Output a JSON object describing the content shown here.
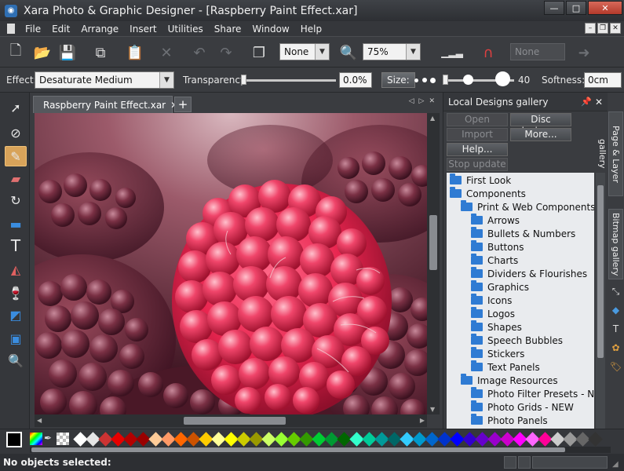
{
  "window": {
    "title": "Xara Photo & Graphic Designer - [Raspberry Paint Effect.xar]",
    "controls": [
      "—",
      "□",
      "✕"
    ]
  },
  "menu": [
    "File",
    "Edit",
    "Arrange",
    "Insert",
    "Utilities",
    "Share",
    "Window",
    "Help"
  ],
  "toolbar": {
    "quality_value": "None",
    "zoom_value": "75%",
    "disabled_combo": "None"
  },
  "infobar": {
    "effect_label": "Effect:",
    "effect_value": "Desaturate Medium",
    "transparency_label": "Transparency",
    "transparency_value": "0.0%",
    "size_button": "Size:",
    "size_value": "40",
    "softness_label": "Softness:",
    "softness_value": "0cm"
  },
  "document_tab": {
    "label": "Raspberry Paint Effect.xar",
    "close": "✕",
    "new_tab": "+"
  },
  "gallery": {
    "title": "Local Designs gallery",
    "buttons": {
      "open": "Open",
      "disc_designs": "Disc designs...",
      "import": "Import",
      "more": "More...",
      "help": "Help...",
      "stop_update": "Stop update"
    },
    "tree": [
      "First Look",
      "Components",
      "Print & Web Components",
      "Arrows",
      "Bullets & Numbers",
      "Buttons",
      "Charts",
      "Dividers & Flourishes",
      "Graphics",
      "Icons",
      "Logos",
      "Shapes",
      "Speech Bubbles",
      "Stickers",
      "Text Panels",
      "Image Resources",
      "Photo Filter Presets - NEW",
      "Photo Grids - NEW",
      "Photo Panels"
    ]
  },
  "side_tabs": [
    "Page & Layer gallery",
    "Bitmap gallery"
  ],
  "palette": [
    "#ffffff",
    "#e6e6e6",
    "#cc3333",
    "#e60000",
    "#b30000",
    "#990000",
    "#ffcc99",
    "#ff9966",
    "#ff6600",
    "#cc5200",
    "#ffcc00",
    "#ffff99",
    "#ffff00",
    "#cccc00",
    "#999900",
    "#ccff66",
    "#99ff33",
    "#66cc00",
    "#339900",
    "#00cc33",
    "#009933",
    "#006600",
    "#33ffcc",
    "#00cc99",
    "#009999",
    "#006666",
    "#33ccff",
    "#0099cc",
    "#0066cc",
    "#0033cc",
    "#0000ff",
    "#3300cc",
    "#6600cc",
    "#9900cc",
    "#cc00cc",
    "#ff00ff",
    "#ff66ff",
    "#ff0099",
    "#cccccc",
    "#999999",
    "#666666",
    "#333333"
  ],
  "status": {
    "text": "No objects selected:"
  }
}
